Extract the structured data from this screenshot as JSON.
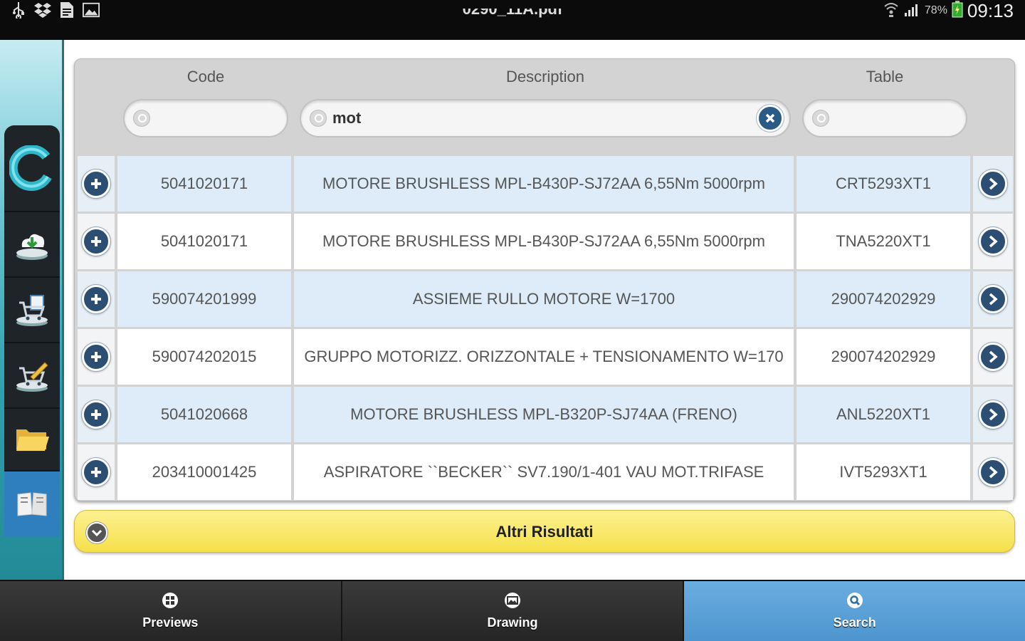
{
  "status_bar": {
    "title": "0290_11A.pdf",
    "battery_percent": "78%",
    "time": "09:13",
    "icons": [
      "usb-icon",
      "dropbox-icon",
      "document-icon",
      "image-icon",
      "wifi-icon",
      "signal-icon",
      "battery-icon"
    ]
  },
  "sidebar": {
    "items": [
      {
        "name": "app-logo-icon"
      },
      {
        "name": "cloud-download-icon"
      },
      {
        "name": "cart-add-icon"
      },
      {
        "name": "cart-edit-icon"
      },
      {
        "name": "folder-icon"
      },
      {
        "name": "book-icon",
        "active": true
      }
    ]
  },
  "table": {
    "headers": {
      "code": "Code",
      "description": "Description",
      "table": "Table"
    },
    "filters": {
      "code": "",
      "description": "mot",
      "table": ""
    },
    "rows": [
      {
        "code": "5041020171",
        "description": "MOTORE BRUSHLESS MPL-B430P-SJ72AA 6,55Nm 5000rpm",
        "table": "CRT5293XT1"
      },
      {
        "code": "5041020171",
        "description": "MOTORE BRUSHLESS MPL-B430P-SJ72AA 6,55Nm 5000rpm",
        "table": "TNA5220XT1"
      },
      {
        "code": "590074201999",
        "description": "ASSIEME RULLO MOTORE W=1700",
        "table": "290074202929"
      },
      {
        "code": "590074202015",
        "description": "GRUPPO MOTORIZZ. ORIZZONTALE + TENSIONAMENTO W=170",
        "table": "290074202929"
      },
      {
        "code": "5041020668",
        "description": "MOTORE BRUSHLESS MPL-B320P-SJ74AA (FRENO)",
        "table": "ANL5220XT1"
      },
      {
        "code": "203410001425",
        "description": "ASPIRATORE ``BECKER`` SV7.190/1-401 VAU MOT.TRIFASE",
        "table": "IVT5293XT1"
      }
    ]
  },
  "more_results": {
    "label": "Altri Risultati"
  },
  "tabs": [
    {
      "label": "Previews",
      "icon": "grid-icon",
      "active": false
    },
    {
      "label": "Drawing",
      "icon": "picture-icon",
      "active": false
    },
    {
      "label": "Search",
      "icon": "search-icon",
      "active": true
    }
  ],
  "colors": {
    "accent_blue": "#4d95cf",
    "button_navy": "#2c4e72",
    "more_yellow": "#f6e04a",
    "row_stripe": "#ddecf8"
  }
}
